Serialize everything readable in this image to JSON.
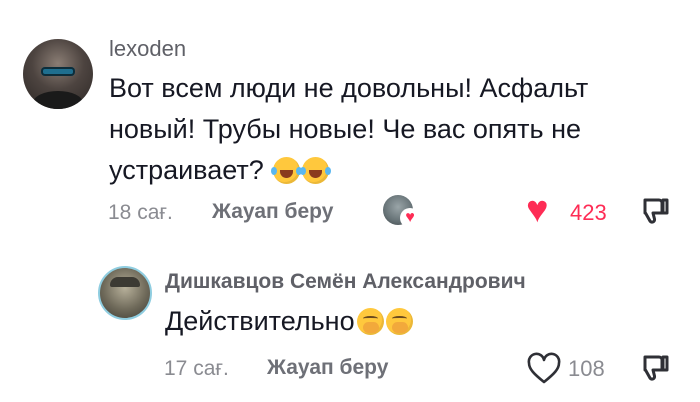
{
  "comment": {
    "username": "lexoden",
    "text": "Вот всем люди не довольны! Асфальт новый! Трубы новые! Че вас опять не устраивает?",
    "emojis": [
      "rolling-on-floor-laughing",
      "rolling-on-floor-laughing"
    ],
    "time": "18 сағ.",
    "reply_label": "Жауап беру",
    "likes": "423",
    "liked": true
  },
  "reply": {
    "username": "Дишкавцов Семён Александрович",
    "text": "Действительно",
    "emojis": [
      "face-with-hand-over-mouth",
      "face-with-hand-over-mouth"
    ],
    "time": "17 сағ.",
    "reply_label": "Жауап беру",
    "likes": "108",
    "liked": false
  },
  "colors": {
    "accent_red": "#fe2c55",
    "text_primary": "#161823",
    "text_secondary": "#8a8b91"
  }
}
